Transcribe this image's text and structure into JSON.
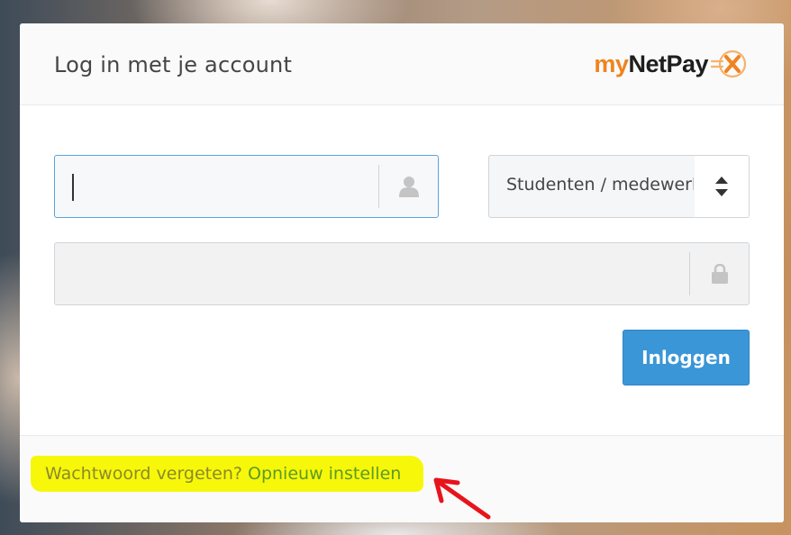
{
  "header": {
    "title": "Log in met je account",
    "logo": {
      "my": "my",
      "netpay": "NetPay",
      "mark_icon": "netpay-x-icon"
    }
  },
  "form": {
    "username": {
      "value": "",
      "placeholder": "",
      "icon": "user-icon"
    },
    "user_type": {
      "selected": "Studenten / medewerkers",
      "icon": "sort-arrows-icon"
    },
    "password": {
      "value": "",
      "placeholder": "",
      "icon": "lock-icon"
    },
    "submit_label": "Inloggen"
  },
  "footer": {
    "forgot_text": "Wachtwoord vergeten?",
    "reset_link": "Opnieuw instellen"
  },
  "colors": {
    "brand_orange": "#f0831f",
    "button_blue": "#3a96d6",
    "focus_blue": "#5aa3df",
    "highlight_yellow": "#f7f70a",
    "annotation_red": "#e8141b"
  }
}
